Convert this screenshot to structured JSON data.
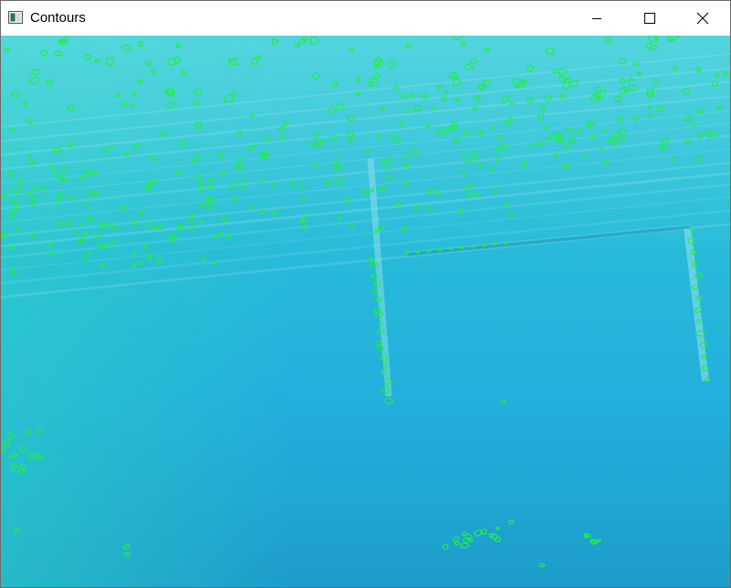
{
  "window": {
    "title": "Contours",
    "controls": {
      "minimize_icon": "minimize-icon",
      "maximize_icon": "maximize-icon",
      "close_icon": "close-icon"
    }
  },
  "image": {
    "description_colors": {
      "water_top": "#31c4d6",
      "water_mid": "#21b2dc",
      "water_bottom": "#1d9fcc",
      "contour": "#22ee44"
    }
  }
}
